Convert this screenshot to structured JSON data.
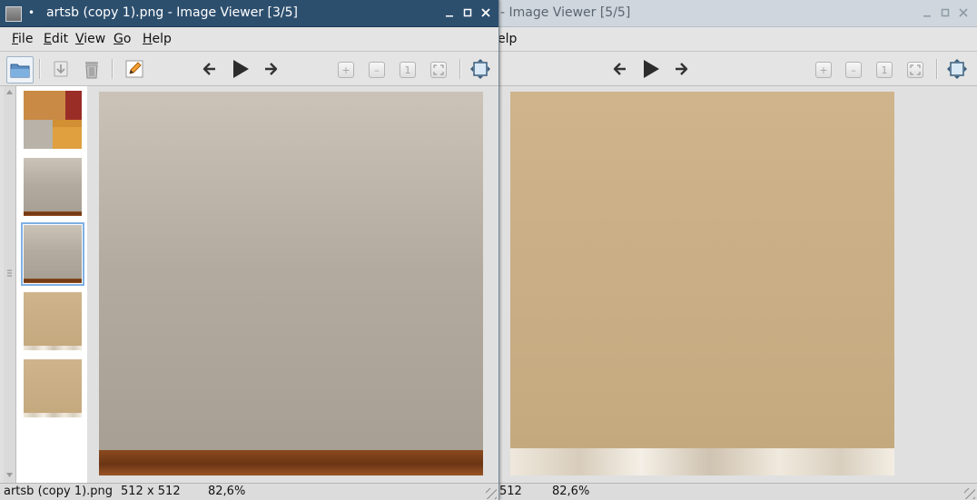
{
  "windows": [
    {
      "id": "front",
      "title": "artsb (copy 1).png - Image Viewer [3/5]",
      "menu": [
        "File",
        "Edit",
        "View",
        "Go",
        "Help"
      ],
      "thumbnails": [
        {
          "kind": "texture-atlas"
        },
        {
          "kind": "gray-wall-wood-floor"
        },
        {
          "kind": "gray-wall-wood-floor",
          "selected": true
        },
        {
          "kind": "tan-wall-marble-floor"
        },
        {
          "kind": "tan-wall-marble-floor"
        }
      ],
      "status": {
        "filename": "artsb (copy 1).png",
        "dimensions": "512 x 512",
        "zoom": "82,6%"
      }
    },
    {
      "id": "back",
      "title": "- Image Viewer [5/5]",
      "menu_visible_fragment": "elp",
      "status": {
        "dimensions_fragment": "512",
        "zoom": "82,6%"
      }
    }
  ],
  "icons": {
    "window_icon": "image-viewer-icon",
    "open": "folder-open-icon",
    "save": "save-icon",
    "delete": "trash-icon",
    "edit": "pencil-edit-icon",
    "prev": "arrow-left-icon",
    "play": "play-slideshow-icon",
    "next": "arrow-right-icon",
    "zoom_in": "zoom-in-icon",
    "zoom_out": "zoom-out-icon",
    "original_size": "zoom-original-icon",
    "fit": "zoom-fit-icon",
    "fullscreen": "fullscreen-icon"
  },
  "colors": {
    "active_titlebar": "#2d4f6e",
    "inactive_titlebar": "#cfd6dd",
    "selection_outline": "#7fb0e5"
  }
}
